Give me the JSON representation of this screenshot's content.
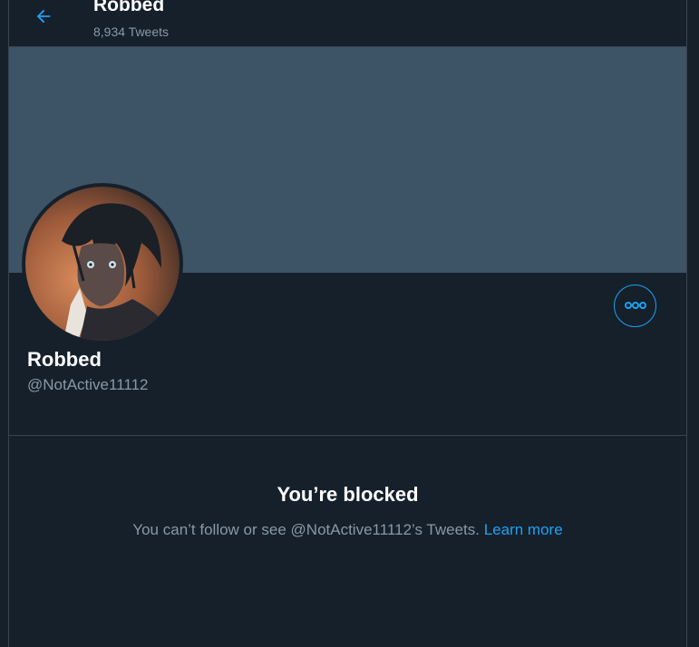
{
  "header": {
    "title": "Robbed",
    "tweet_count": "8,934 Tweets",
    "back_icon": "back-arrow-icon"
  },
  "profile": {
    "name": "Robbed",
    "handle": "@NotActive11112",
    "more_icon": "more-options-icon"
  },
  "blocked": {
    "title": "You’re blocked",
    "description": "You can’t follow or see @NotActive11112’s Tweets.",
    "link_label": "Learn more"
  },
  "colors": {
    "background": "#15202b",
    "banner": "#3d5466",
    "accent": "#1da1f2",
    "muted_text": "#8899a6",
    "border": "#38444d"
  }
}
